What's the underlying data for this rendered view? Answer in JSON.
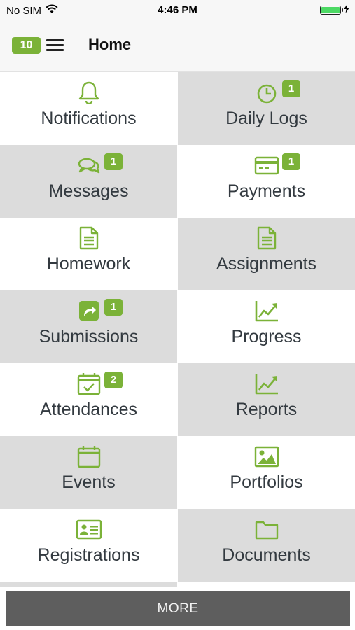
{
  "status_bar": {
    "carrier": "No SIM",
    "time": "4:46 PM"
  },
  "navbar": {
    "badge": "10",
    "title": "Home"
  },
  "colors": {
    "accent": "#7bb238",
    "tile_grey": "#dcdcdc",
    "more_button": "#5e5e5e"
  },
  "tiles": [
    {
      "label": "Notifications",
      "icon": "bell-icon",
      "count": ""
    },
    {
      "label": "Daily Logs",
      "icon": "clock-icon",
      "count": "1"
    },
    {
      "label": "Messages",
      "icon": "chat-bubbles-icon",
      "count": "1"
    },
    {
      "label": "Payments",
      "icon": "credit-card-icon",
      "count": "1"
    },
    {
      "label": "Homework",
      "icon": "document-icon",
      "count": ""
    },
    {
      "label": "Assignments",
      "icon": "document-icon",
      "count": ""
    },
    {
      "label": "Submissions",
      "icon": "share-arrow-icon",
      "count": "1"
    },
    {
      "label": "Progress",
      "icon": "line-chart-icon",
      "count": ""
    },
    {
      "label": "Attendances",
      "icon": "calendar-check-icon",
      "count": "2"
    },
    {
      "label": "Reports",
      "icon": "line-chart-icon",
      "count": ""
    },
    {
      "label": "Events",
      "icon": "calendar-icon",
      "count": ""
    },
    {
      "label": "Portfolios",
      "icon": "image-icon",
      "count": ""
    },
    {
      "label": "Registrations",
      "icon": "id-card-icon",
      "count": ""
    },
    {
      "label": "Documents",
      "icon": "folder-icon",
      "count": ""
    }
  ],
  "more_button": {
    "label": "MORE"
  }
}
